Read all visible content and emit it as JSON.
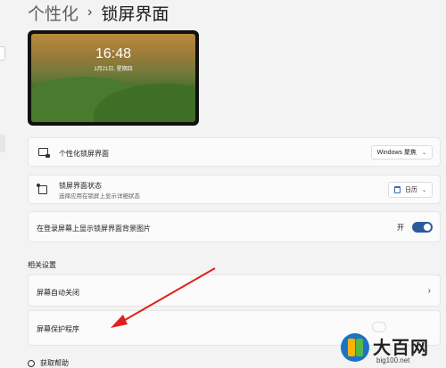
{
  "header": {
    "parent": "个性化",
    "separator": "›",
    "current": "锁屏界面"
  },
  "preview": {
    "time": "16:48",
    "date": "1月21日, 星期四"
  },
  "settings": {
    "lock_screen": {
      "title": "个性化锁屏界面",
      "value": "Windows 聚焦"
    },
    "status": {
      "title": "锁屏界面状态",
      "subtitle": "选择应用在锁屏上显示详细状态",
      "value": "日历"
    },
    "login_bg": {
      "title": "在登录屏幕上显示锁屏界面背景图片",
      "toggle_label": "开",
      "toggle_on": true
    }
  },
  "related": {
    "section_title": "相关设置",
    "timeout": {
      "title": "屏幕自动关闭"
    },
    "screensaver": {
      "title": "屏幕保护程序"
    }
  },
  "help": {
    "label": "获取帮助"
  },
  "watermark": {
    "title": "大百网",
    "url": "big100.net"
  },
  "colors": {
    "accent": "#2d5a9a",
    "arrow": "#e0201a",
    "background": "#f3f3f3"
  }
}
